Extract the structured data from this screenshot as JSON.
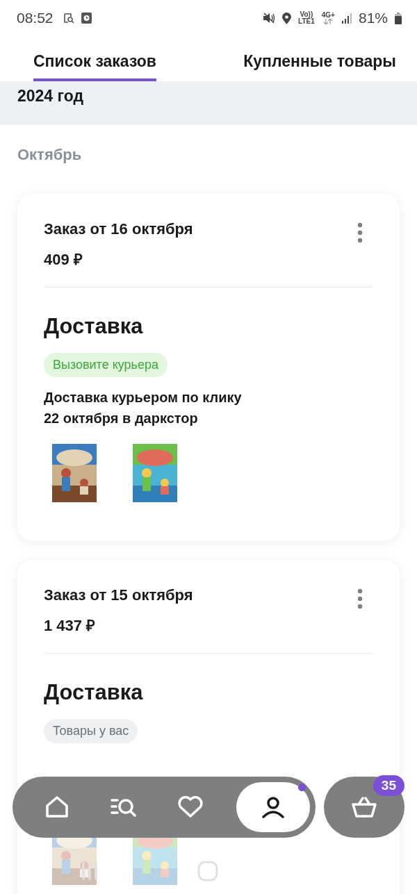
{
  "status_bar": {
    "time": "08:52",
    "volte": "Vo))",
    "lte": "LTE1",
    "network": "4G+",
    "battery": "81%"
  },
  "tabs": [
    {
      "label": "Список заказов",
      "selected": true
    },
    {
      "label": "Купленные товары",
      "selected": false
    }
  ],
  "year": "2024 год",
  "month": "Октябрь",
  "orders": [
    {
      "title": "Заказ от 16 октября",
      "price": "409 ₽",
      "delivery_heading": "Доставка",
      "status": {
        "label": "Вызовите курьера",
        "kind": "action"
      },
      "delivery_lines": [
        "Доставка курьером по клику",
        "22 октября в даркстор"
      ]
    },
    {
      "title": "Заказ от 15 октября",
      "price": "1 437 ₽",
      "delivery_heading": "Доставка",
      "status": {
        "label": "Товары у вас",
        "kind": "neutral"
      }
    }
  ],
  "bottom_nav": {
    "items": [
      {
        "kind": "home",
        "selected": false
      },
      {
        "kind": "catalog",
        "selected": false
      },
      {
        "kind": "favorites",
        "selected": false
      },
      {
        "kind": "profile",
        "selected": true,
        "dot": true
      }
    ],
    "cart_count": "35"
  }
}
